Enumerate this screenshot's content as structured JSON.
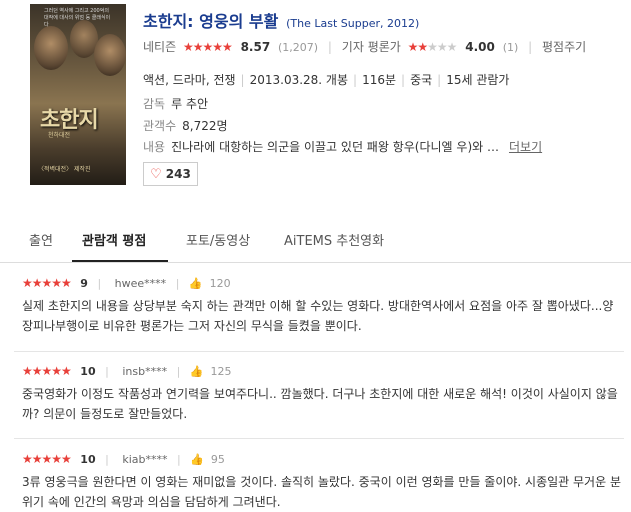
{
  "poster": {
    "caption": "그러던 역사에 그리고 200억의 대작에 대사의 위엄 등 클래식이다",
    "title": "초한지",
    "subtitle": "천하대전",
    "bottom": "〈적벽대전〉 제작진"
  },
  "movie": {
    "title_ko": "초한지: 영웅의 부활",
    "title_en": "(The Last Supper, 2012)",
    "netizen_label": "네티즌",
    "netizen_stars": "★★★★★",
    "netizen_score": "8.57",
    "netizen_count": "(1,207)",
    "critic_label": "기자 평론가",
    "critic_stars": "★★★★★",
    "critic_score": "4.00",
    "critic_count": "(1)",
    "my_rating_label": "평점주기",
    "genre": "액션, 드라마, 전쟁",
    "release": "2013.03.28. 개봉",
    "runtime": "116분",
    "country": "중국",
    "age": "15세 관람가",
    "director_label": "감독",
    "director": "루 추안",
    "audience_label": "관객수",
    "audience": "8,722명",
    "desc_label": "내용",
    "desc": "진나라에 대항하는 의군을 이끌고 있던 패왕 항우(다니엘 우)와 …",
    "more": "더보기",
    "likes": "243"
  },
  "tabs": [
    {
      "label": "출연"
    },
    {
      "label": "관람객 평점"
    },
    {
      "label": "포토/동영상"
    },
    {
      "label": "AiTEMS 추천영화"
    }
  ],
  "reviews": [
    {
      "stars": "★★★★★",
      "score": "9",
      "user": "hwee****",
      "likes": "120",
      "text": "실제 초한지의 내용을 상당부분 숙지 하는 관객만 이해 할 수있는 영화다. 방대한역사에서 요점을 아주 잘 뽑아냈다...양장피나부행이로 비유한 평론가는 그저 자신의 무식을 들켰을 뿐이다."
    },
    {
      "stars": "★★★★★",
      "score": "10",
      "user": "insb****",
      "likes": "125",
      "text": "중국영화가 이정도 작품성과 연기력을 보여주다니.. 깜놀했다. 더구나 초한지에 대한 새로운 해석! 이것이 사실이지 않을까? 의문이 들정도로 잘만들었다."
    },
    {
      "stars": "★★★★★",
      "score": "10",
      "user": "kiab****",
      "likes": "95",
      "text": "3류 영웅극을 원한다면 이 영화는 재미없을 것이다. 솔직히 놀랐다. 중국이 이런 영화를 만들 줄이야. 시종일관 무거운 분위기 속에 인간의 욕망과 의심을 담담하게 그려낸다."
    }
  ],
  "colors": {
    "title": "#1a3c8f",
    "star": "#e8403a",
    "heart": "#e8403a"
  }
}
